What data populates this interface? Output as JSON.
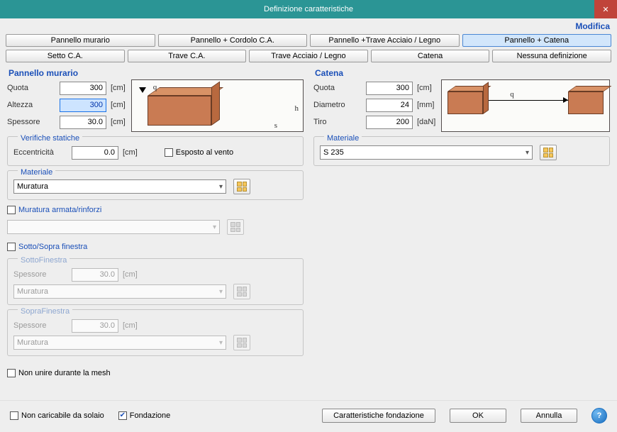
{
  "window": {
    "title": "Definizione caratteristiche",
    "close": "✕"
  },
  "modifica": "Modifica",
  "tabs_top": [
    "Pannello murario",
    "Pannello + Cordolo C.A.",
    "Pannello +Trave Acciaio / Legno",
    "Pannello + Catena"
  ],
  "tabs_bottom": [
    "Setto C.A.",
    "Trave C.A.",
    "Trave Acciaio / Legno",
    "Catena",
    "Nessuna definizione"
  ],
  "tabs_top_selected": 3,
  "left": {
    "title": "Pannello murario",
    "quota": {
      "label": "Quota",
      "value": "300",
      "unit": "[cm]"
    },
    "altezza": {
      "label": "Altezza",
      "value": "300",
      "unit": "[cm]"
    },
    "spessore": {
      "label": "Spessore",
      "value": "30.0",
      "unit": "[cm]"
    },
    "verifiche": {
      "title": "Verifiche statiche",
      "eccen": {
        "label": "Eccentricità",
        "value": "0.0",
        "unit": "[cm]"
      },
      "vento": "Esposto al vento"
    },
    "materiale": {
      "title": "Materiale",
      "value": "Muratura"
    },
    "armata": {
      "label": "Muratura armata/rinforzi",
      "value": ""
    },
    "sotto_sopra": {
      "label": "Sotto/Sopra finestra",
      "sotto": {
        "title": "SottoFinestra",
        "spessore_label": "Spessore",
        "spessore": "30.0",
        "unit": "[cm]",
        "mat": "Muratura"
      },
      "sopra": {
        "title": "SopraFinestra",
        "spessore_label": "Spessore",
        "spessore": "30.0",
        "unit": "[cm]",
        "mat": "Muratura"
      }
    },
    "non_unire": "Non unire durante la mesh"
  },
  "right": {
    "title": "Catena",
    "quota": {
      "label": "Quota",
      "value": "300",
      "unit": "[cm]"
    },
    "diametro": {
      "label": "Diametro",
      "value": "24",
      "unit": "[mm]"
    },
    "tiro": {
      "label": "Tiro",
      "value": "200",
      "unit": "[daN]"
    },
    "materiale": {
      "title": "Materiale",
      "value": "S 235"
    }
  },
  "footer": {
    "non_caricabile": "Non caricabile da solaio",
    "fondazione": "Fondazione",
    "car_fond": "Caratteristiche fondazione",
    "ok": "OK",
    "annulla": "Annulla"
  }
}
